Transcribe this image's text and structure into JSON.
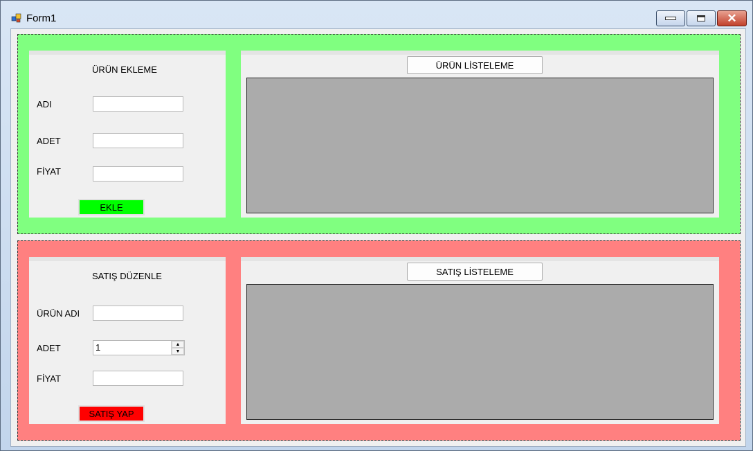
{
  "window": {
    "title": "Form1",
    "minimize_icon": "minimize-icon",
    "maximize_icon": "maximize-icon",
    "close_glyph": "✕"
  },
  "colors": {
    "green_panel": "#80ff80",
    "red_panel": "#ff8080",
    "ekle_button": "#00ff00",
    "satis_button": "#ff0000",
    "grid_bg": "#ababab"
  },
  "urun_ekleme": {
    "heading": "ÜRÜN EKLEME",
    "fields": {
      "adi_label": "ADI",
      "adi_value": "",
      "adet_label": "ADET",
      "adet_value": "",
      "fiyat_label": "FİYAT",
      "fiyat_value": ""
    },
    "submit_label": "EKLE"
  },
  "urun_listeleme": {
    "button_label": "ÜRÜN LİSTELEME"
  },
  "satis_duzenle": {
    "heading": "SATIŞ DÜZENLE",
    "fields": {
      "urun_adi_label": "ÜRÜN ADI",
      "urun_adi_value": "",
      "adet_label": "ADET",
      "adet_value": "1",
      "fiyat_label": "FİYAT",
      "fiyat_value": ""
    },
    "submit_label": "SATIŞ YAP"
  },
  "satis_listeleme": {
    "button_label": "SATIŞ LİSTELEME"
  }
}
